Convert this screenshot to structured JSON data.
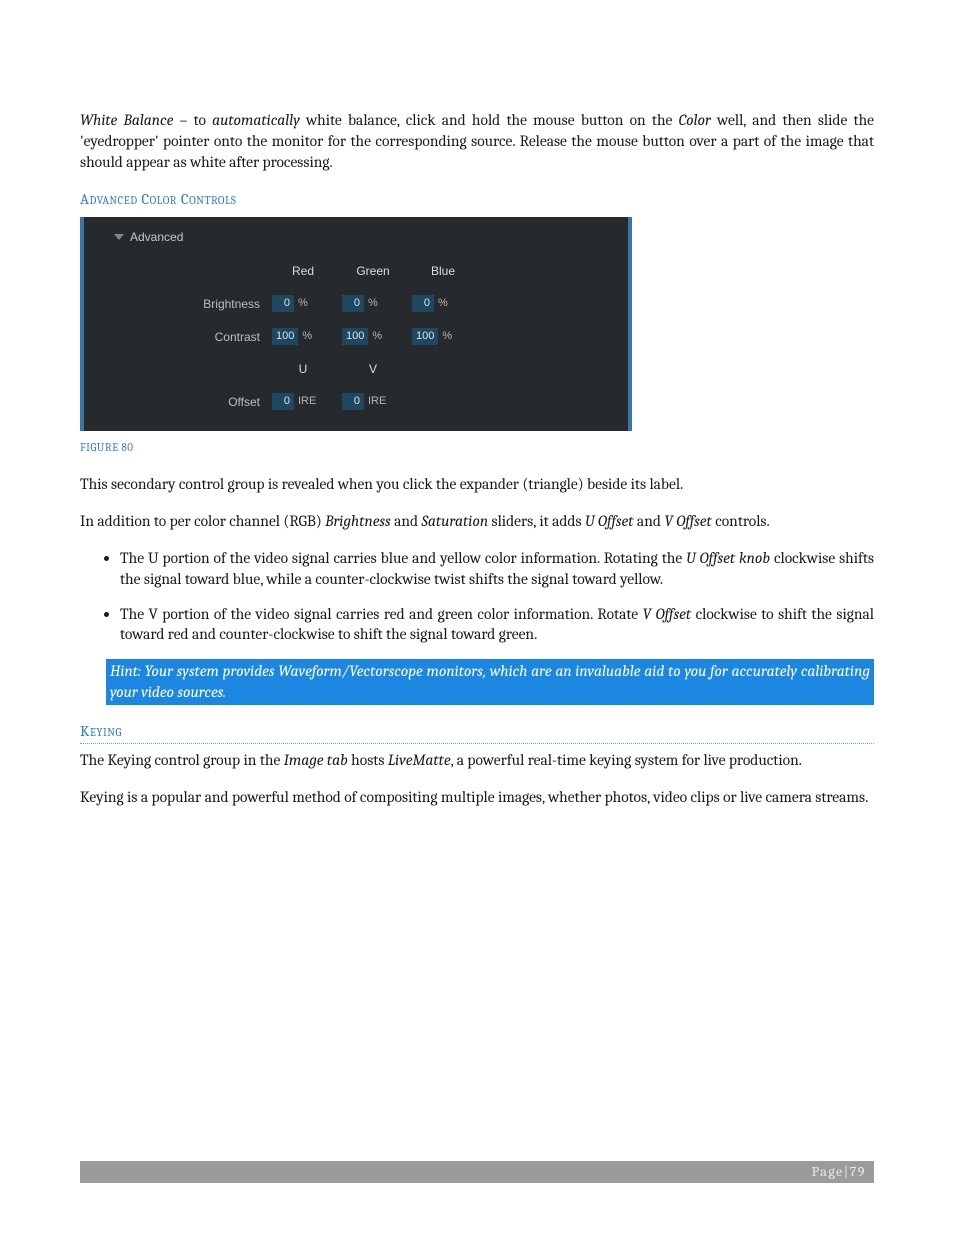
{
  "intro": {
    "wb_label": "White Balance",
    "dash": " – to ",
    "auto": "automatically",
    "wb_rest1": " white balance, click and hold the mouse button on the ",
    "color_word": "Color",
    "wb_rest2": " well, and then slide the 'eyedropper' pointer onto the monitor for the corresponding source.  Release the mouse button over a part of the image that should appear as white after processing."
  },
  "section_adv": "Advanced Color Controls",
  "panel": {
    "header": "Advanced",
    "cols": {
      "red": "Red",
      "green": "Green",
      "blue": "Blue"
    },
    "rows": {
      "brightness": {
        "label": "Brightness",
        "red": "0",
        "green": "0",
        "blue": "0",
        "unit": "%"
      },
      "contrast": {
        "label": "Contrast",
        "red": "100",
        "green": "100",
        "blue": "100",
        "unit": "%"
      },
      "uv_cols": {
        "u": "U",
        "v": "V"
      },
      "offset": {
        "label": "Offset",
        "u": "0",
        "v": "0",
        "unit": "IRE"
      }
    }
  },
  "figcap": "FIGURE 80",
  "p_after_fig": "This secondary control group is revealed when you click the expander (triangle) beside its label.",
  "p_addition": {
    "t1": "In addition to per color channel (RGB) ",
    "i1": "Brightness",
    "t2": " and ",
    "i2": "Saturation",
    "t3": " sliders, it adds ",
    "i3": "U Offset",
    "t4": " and ",
    "i4": "V Offset",
    "t5": " controls."
  },
  "bullets": {
    "u1a": "The U portion of the video signal carries blue and yellow color information. Rotating the ",
    "u1i": "U Offset knob",
    "u1b": " clockwise shifts the signal toward blue, while a counter-clockwise twist shifts the signal toward yellow.",
    "v1a": "The V portion of the video signal carries red and green color information. Rotate ",
    "v1i": "V Offset",
    "v1b": " clockwise to shift the signal toward red and counter-clockwise to shift the signal toward green."
  },
  "hint": "Hint: Your system provides Waveform/Vectorscope monitors, which are an invaluable aid to you for accurately calibrating your video sources.",
  "section_keying": "Keying",
  "keying_p1": {
    "t1": "The Keying control group in the ",
    "i1": "Image tab",
    "t2": " hosts ",
    "i2": "LiveMatte",
    "t3": ", a powerful real-time keying system for live production."
  },
  "keying_p2": "Keying is a popular and powerful method of compositing multiple images, whether photos, video clips or live camera streams.",
  "footer": {
    "page_word": "Page",
    "sep": " | ",
    "num": "79"
  }
}
